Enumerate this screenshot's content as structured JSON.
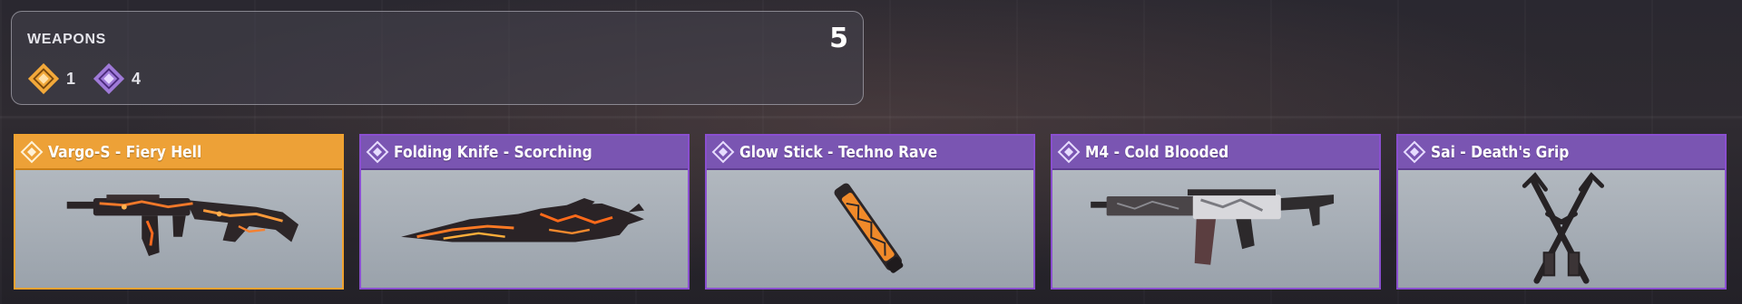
{
  "summary": {
    "title": "WEAPONS",
    "total": "5",
    "rarities": [
      {
        "icon": "legendary-rarity-icon",
        "count": "1",
        "color": "#f3a93a"
      },
      {
        "icon": "epic-rarity-icon",
        "count": "4",
        "color": "#9f7ad8"
      }
    ]
  },
  "items": [
    {
      "name": "Vargo-S - Fiery Hell",
      "rarity": "legendary",
      "icon": "assault-rifle-icon"
    },
    {
      "name": "Folding Knife - Scorching",
      "rarity": "epic",
      "icon": "knife-icon"
    },
    {
      "name": "Glow Stick - Techno Rave",
      "rarity": "epic",
      "icon": "glow-stick-icon"
    },
    {
      "name": "M4 - Cold Blooded",
      "rarity": "epic",
      "icon": "rifle-icon"
    },
    {
      "name": "Sai - Death's Grip",
      "rarity": "epic",
      "icon": "sai-icon"
    }
  ],
  "colors": {
    "legendary": "#eda137",
    "epic": "#7a55b2"
  }
}
